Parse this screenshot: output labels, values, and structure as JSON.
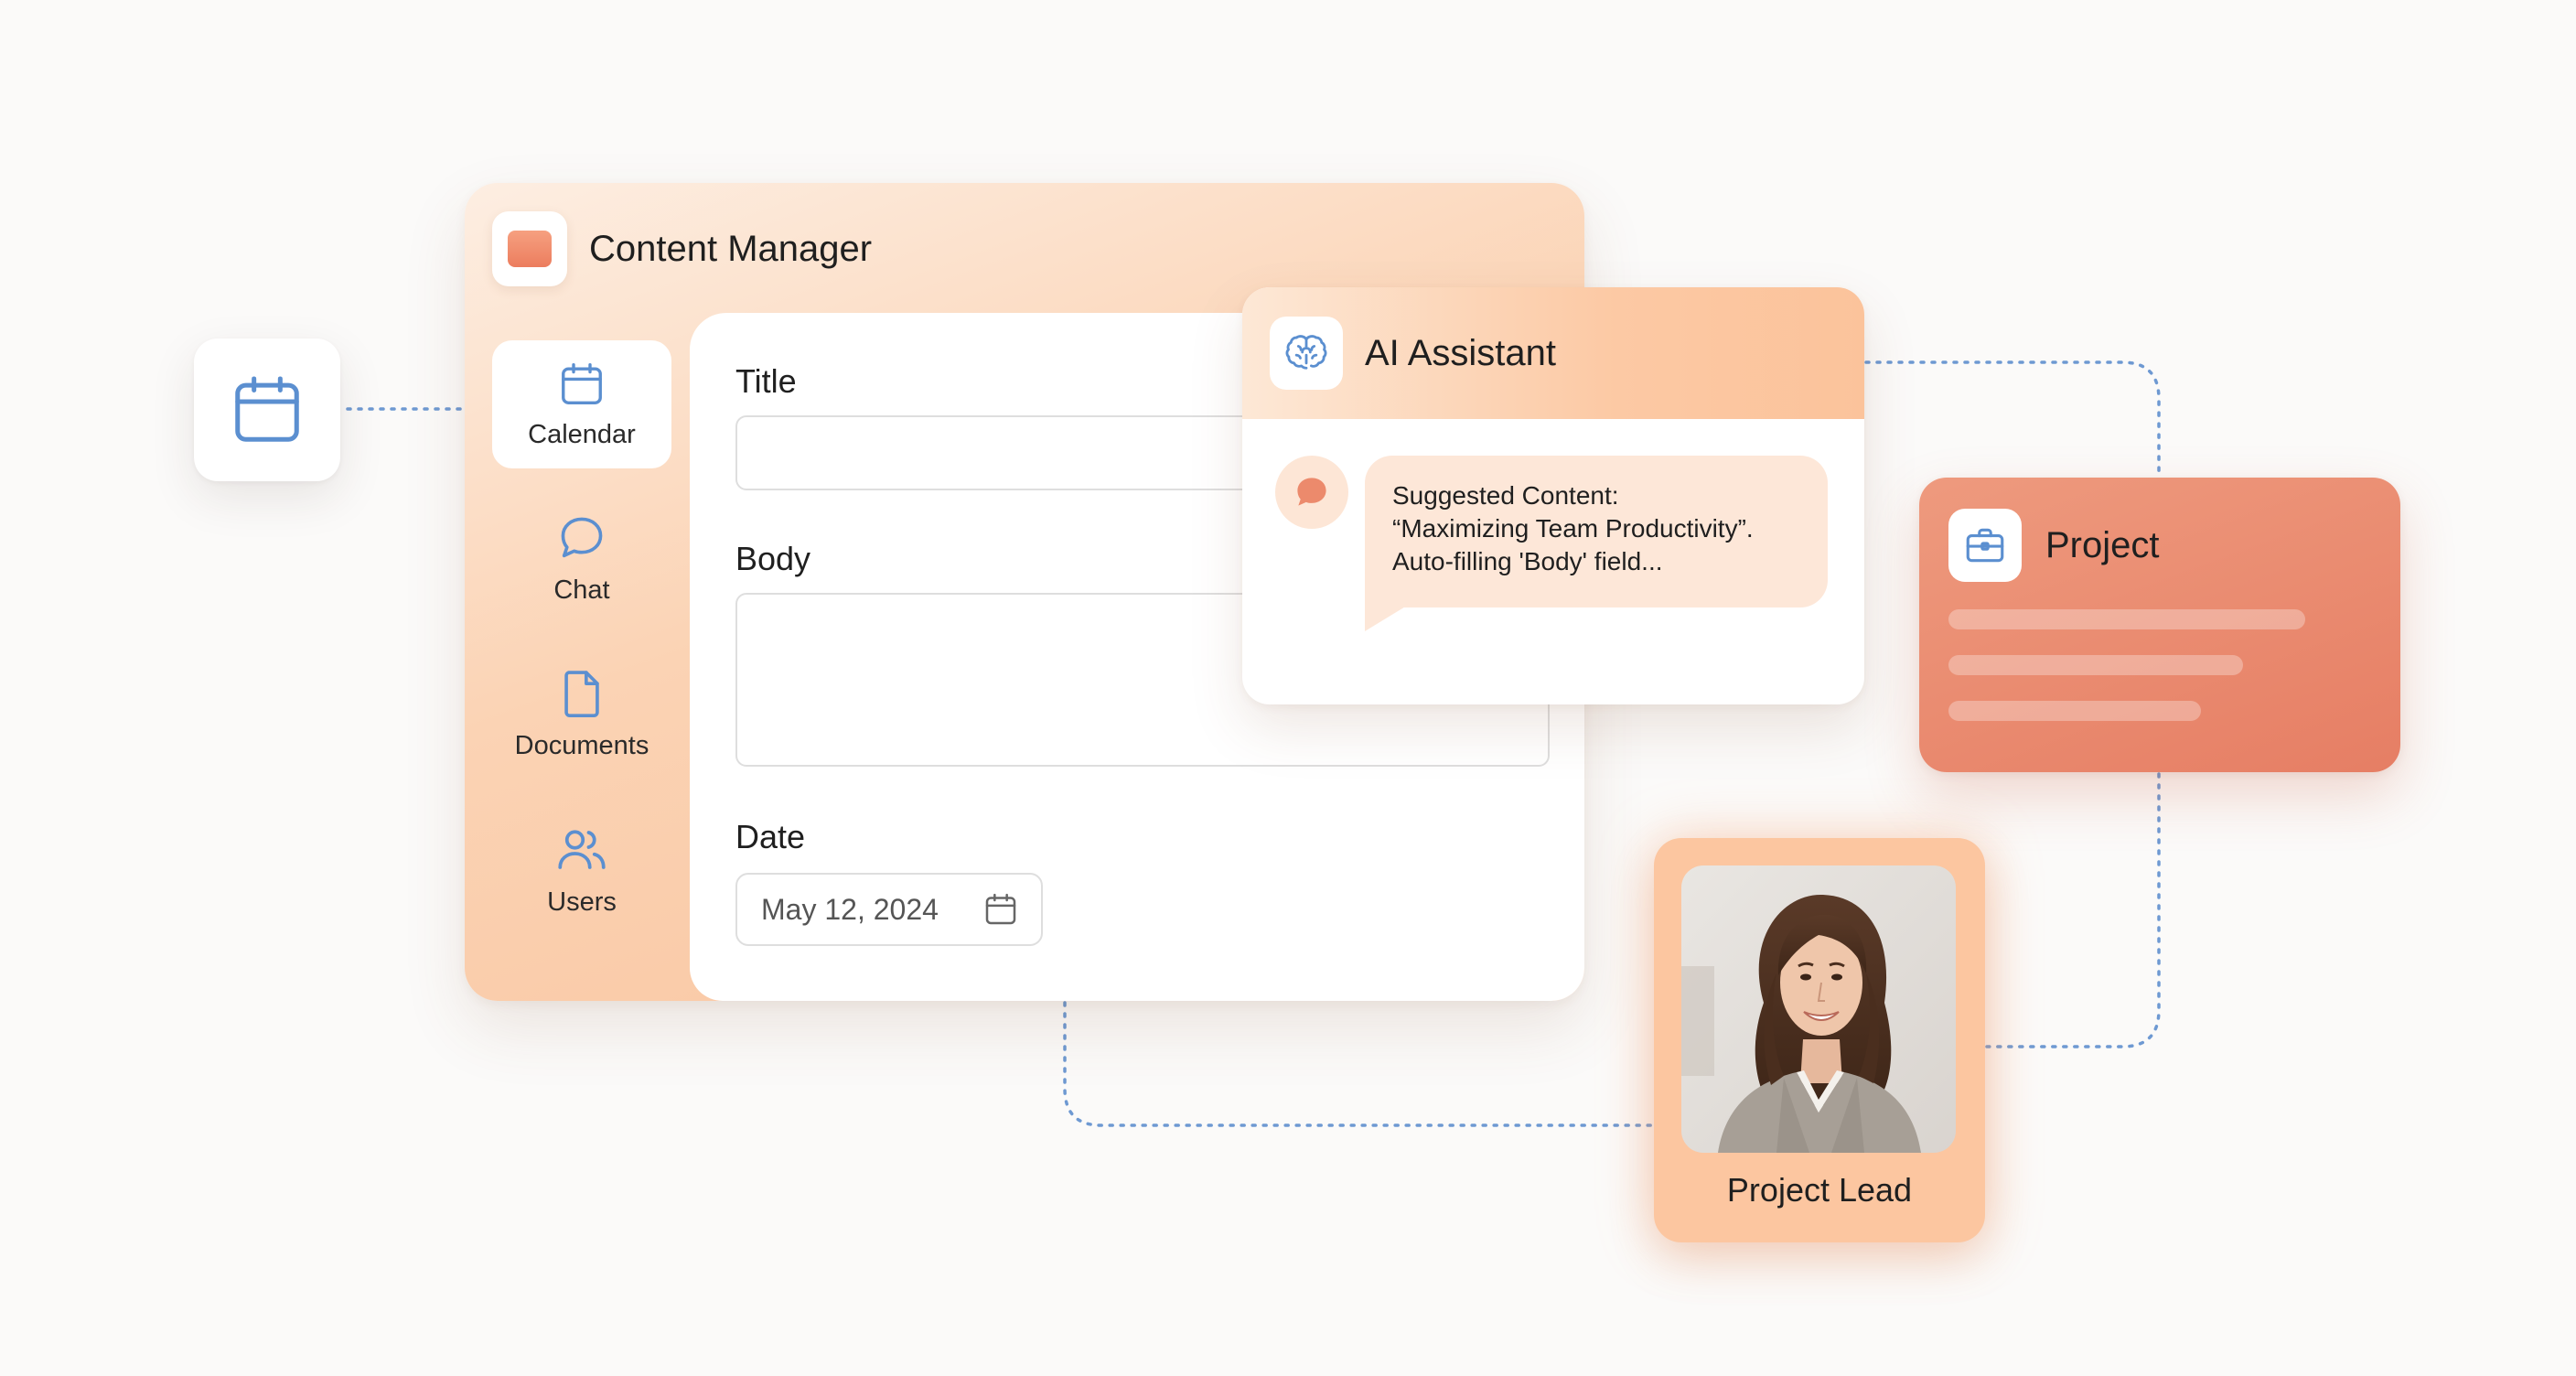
{
  "content_manager": {
    "title": "Content Manager",
    "nav": [
      {
        "label": "Calendar",
        "icon": "calendar-icon",
        "active": true
      },
      {
        "label": "Chat",
        "icon": "chat-icon",
        "active": false
      },
      {
        "label": "Documents",
        "icon": "document-icon",
        "active": false
      },
      {
        "label": "Users",
        "icon": "users-icon",
        "active": false
      }
    ],
    "form": {
      "title_label": "Title",
      "title_value": "",
      "body_label": "Body",
      "body_value": "",
      "date_label": "Date",
      "date_value": "May 12, 2024"
    }
  },
  "ai_assistant": {
    "title": "AI Assistant",
    "message_lines": [
      "Suggested Content:",
      "“Maximizing Team Productivity”.",
      "Auto-filling 'Body' field..."
    ]
  },
  "project": {
    "title": "Project",
    "icon": "briefcase-icon"
  },
  "project_lead": {
    "label": "Project Lead"
  },
  "colors": {
    "accent_peach": "#fbc39b",
    "accent_coral": "#e67e64",
    "icon_blue": "#5b8fd0",
    "connector": "#6e99d2"
  }
}
